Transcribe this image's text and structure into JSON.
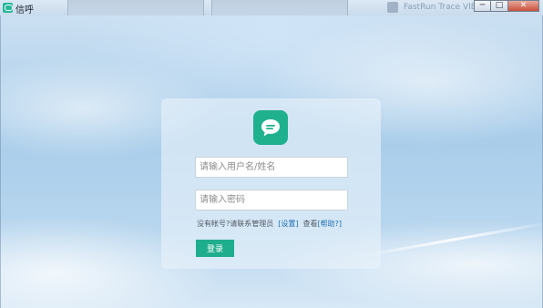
{
  "window": {
    "title": "信呼",
    "buttons": {
      "minimize": "─",
      "maximize": "□",
      "close": "✕"
    },
    "background_app_text": "FastRun Trace VIE"
  },
  "login": {
    "username_placeholder": "请输入用户名/姓名",
    "password_placeholder": "请输入密码",
    "no_account_text": "没有帐号?请联系管理员",
    "settings_link": "[设置]",
    "view_text": "查看",
    "help_link": "[帮助?]",
    "submit_label": "登录"
  },
  "colors": {
    "brand": "#1fb18e",
    "link": "#1d6fb0"
  },
  "icons": {
    "app": "chat-bubble-icon",
    "logo": "chat-bubble-icon"
  }
}
